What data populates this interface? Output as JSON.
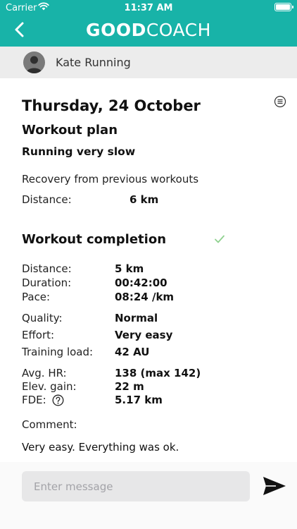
{
  "status": {
    "carrier": "Carrier",
    "time": "11:37 AM"
  },
  "header": {
    "logo_bold": "GOOD",
    "logo_light": "COACH",
    "back_icon": "chevron-left-icon"
  },
  "user": {
    "name": "Kate Running",
    "avatar_icon": "user-silhouette-icon"
  },
  "day": {
    "date": "Thursday, 24 October",
    "menu_icon": "list-menu-icon"
  },
  "plan": {
    "heading": "Workout plan",
    "title": "Running very slow",
    "description": "Recovery from previous workouts",
    "distance_label": "Distance:",
    "distance_value": "6 km"
  },
  "completion": {
    "heading": "Workout completion",
    "status_icon": "checkmark-icon",
    "rows": [
      {
        "label": "Distance:",
        "value": "5 km"
      },
      {
        "label": "Duration:",
        "value": "00:42:00"
      },
      {
        "label": "Pace:",
        "value": "08:24 /km"
      },
      {
        "label": "Quality:",
        "value": "Normal"
      },
      {
        "label": "Effort:",
        "value": "Very easy"
      },
      {
        "label": "Training load:",
        "value": "42 AU"
      },
      {
        "label": "Avg. HR:",
        "value": "138 (max 142)"
      },
      {
        "label": "Elev. gain:",
        "value": "22 m"
      },
      {
        "label": "FDE:",
        "value": "5.17 km"
      }
    ],
    "comment_label": "Comment:",
    "comment_text": "Very easy. Everything was ok."
  },
  "composer": {
    "placeholder": "Enter message",
    "send_icon": "send-icon"
  },
  "colors": {
    "header": "#18b3a8",
    "userbar": "#ececec",
    "check": "#8fd18f",
    "input_bg": "#e7e7e8"
  }
}
